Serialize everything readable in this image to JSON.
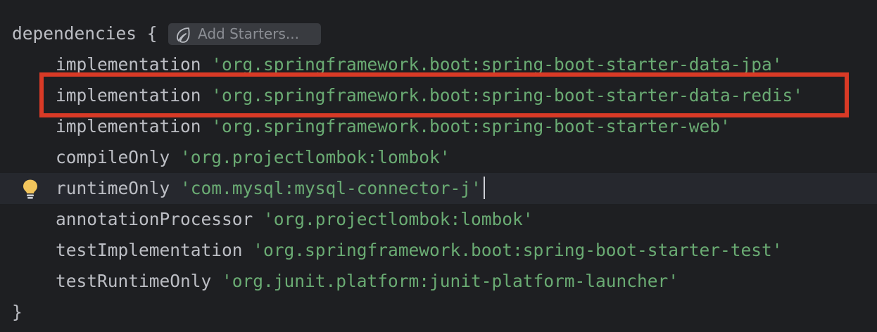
{
  "editor": {
    "header": {
      "keyword": "dependencies",
      "open_brace": "{",
      "add_starters_label": "Add Starters..."
    },
    "lines": [
      {
        "config": "implementation",
        "value": "'org.springframework.boot:spring-boot-starter-data-jpa'"
      },
      {
        "config": "implementation",
        "value": "'org.springframework.boot:spring-boot-starter-data-redis'"
      },
      {
        "config": "implementation",
        "value": "'org.springframework.boot:spring-boot-starter-web'"
      },
      {
        "config": "compileOnly",
        "value": "'org.projectlombok:lombok'"
      },
      {
        "config": "runtimeOnly",
        "value": "'com.mysql:mysql-connector-j'"
      },
      {
        "config": "annotationProcessor",
        "value": "'org.projectlombok:lombok'"
      },
      {
        "config": "testImplementation",
        "value": "'org.springframework.boot:spring-boot-starter-test'"
      },
      {
        "config": "testRuntimeOnly",
        "value": "'org.junit.platform:junit-platform-launcher'"
      }
    ],
    "close_brace": "}",
    "colors": {
      "background": "#1e1f22",
      "current_line": "#26282e",
      "string": "#6aab73",
      "identifier": "#bcbec4",
      "highlight_box": "#d93a26",
      "bulb": "#f2c55c"
    },
    "icons": {
      "starter": "spring-leaf-icon",
      "intention": "lightbulb-icon"
    }
  }
}
